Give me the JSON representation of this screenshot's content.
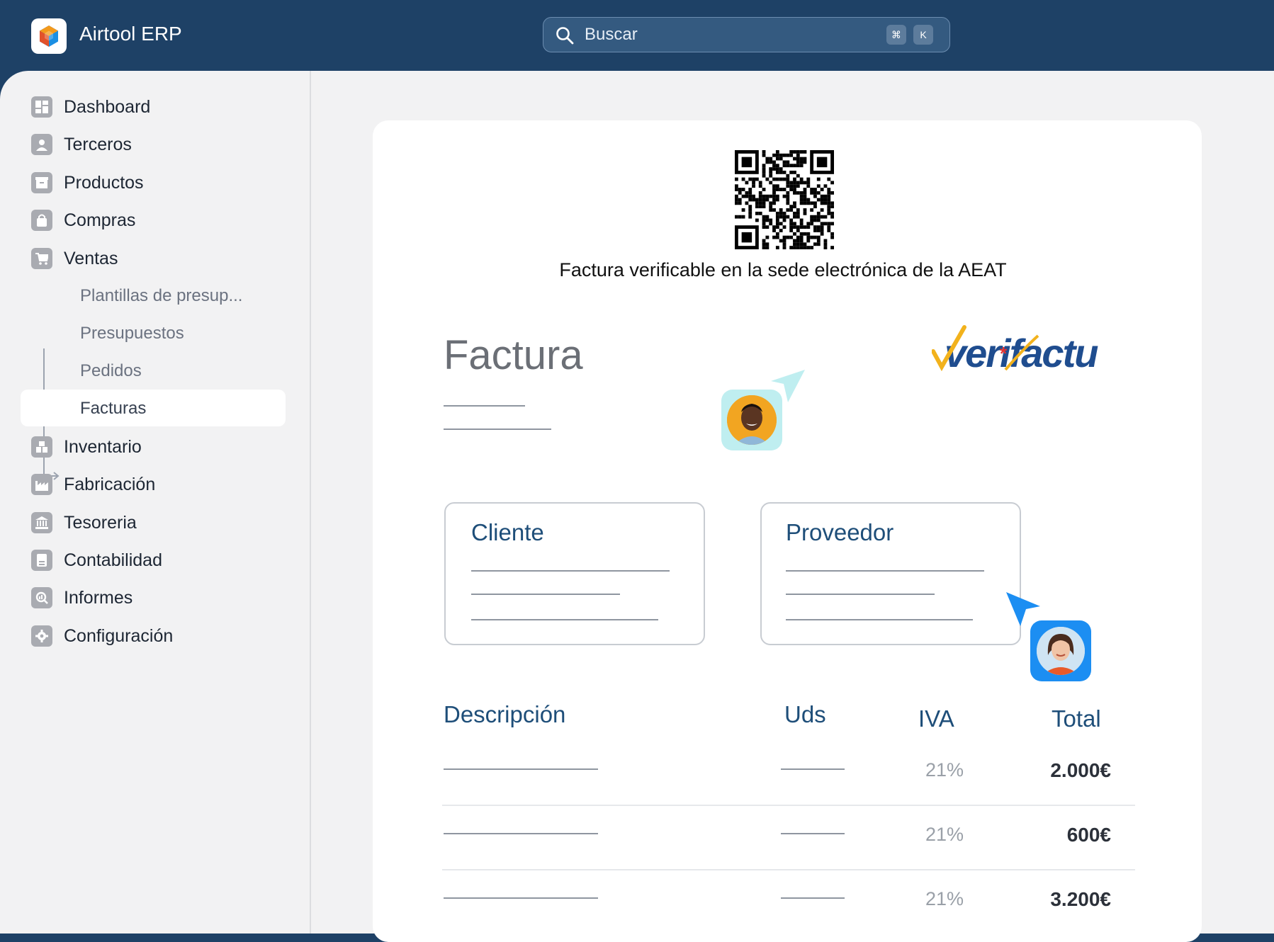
{
  "app": {
    "title": "Airtool ERP"
  },
  "search": {
    "placeholder": "Buscar",
    "shortcut_keys": [
      "⌘",
      "K"
    ]
  },
  "sidebar": {
    "items": [
      {
        "label": "Dashboard",
        "icon": "dashboard-icon"
      },
      {
        "label": "Terceros",
        "icon": "user-icon"
      },
      {
        "label": "Productos",
        "icon": "box-icon"
      },
      {
        "label": "Compras",
        "icon": "bag-icon"
      },
      {
        "label": "Ventas",
        "icon": "cart-icon"
      },
      {
        "label": "Inventario",
        "icon": "warehouse-icon"
      },
      {
        "label": "Fabricación",
        "icon": "factory-icon"
      },
      {
        "label": "Tesoreria",
        "icon": "bank-icon"
      },
      {
        "label": "Contabilidad",
        "icon": "ledger-icon"
      },
      {
        "label": "Informes",
        "icon": "report-search-icon"
      },
      {
        "label": "Configuración",
        "icon": "gear-icon"
      }
    ],
    "ventas_sub": [
      {
        "label": "Plantillas de presup...",
        "active": false
      },
      {
        "label": "Presupuestos",
        "active": false
      },
      {
        "label": "Pedidos",
        "active": false
      },
      {
        "label": "Facturas",
        "active": true
      }
    ]
  },
  "invoice": {
    "qr_caption": "Factura verificable en la sede electrónica de la AEAT",
    "title": "Factura",
    "logo_text": "verifactu",
    "cliente_label": "Cliente",
    "proveedor_label": "Proveedor",
    "columns": {
      "desc": "Descripción",
      "uds": "Uds",
      "iva": "IVA",
      "total": "Total"
    },
    "rows": [
      {
        "iva": "21%",
        "total": "2.000€"
      },
      {
        "iva": "21%",
        "total": "600€"
      },
      {
        "iva": "21%",
        "total": "3.200€"
      }
    ]
  },
  "colors": {
    "topbar": "#1e4166",
    "accent_blue": "#1e4e79",
    "avatar1_bg": "#bfeef0",
    "avatar2_bg": "#1c8ef2"
  }
}
